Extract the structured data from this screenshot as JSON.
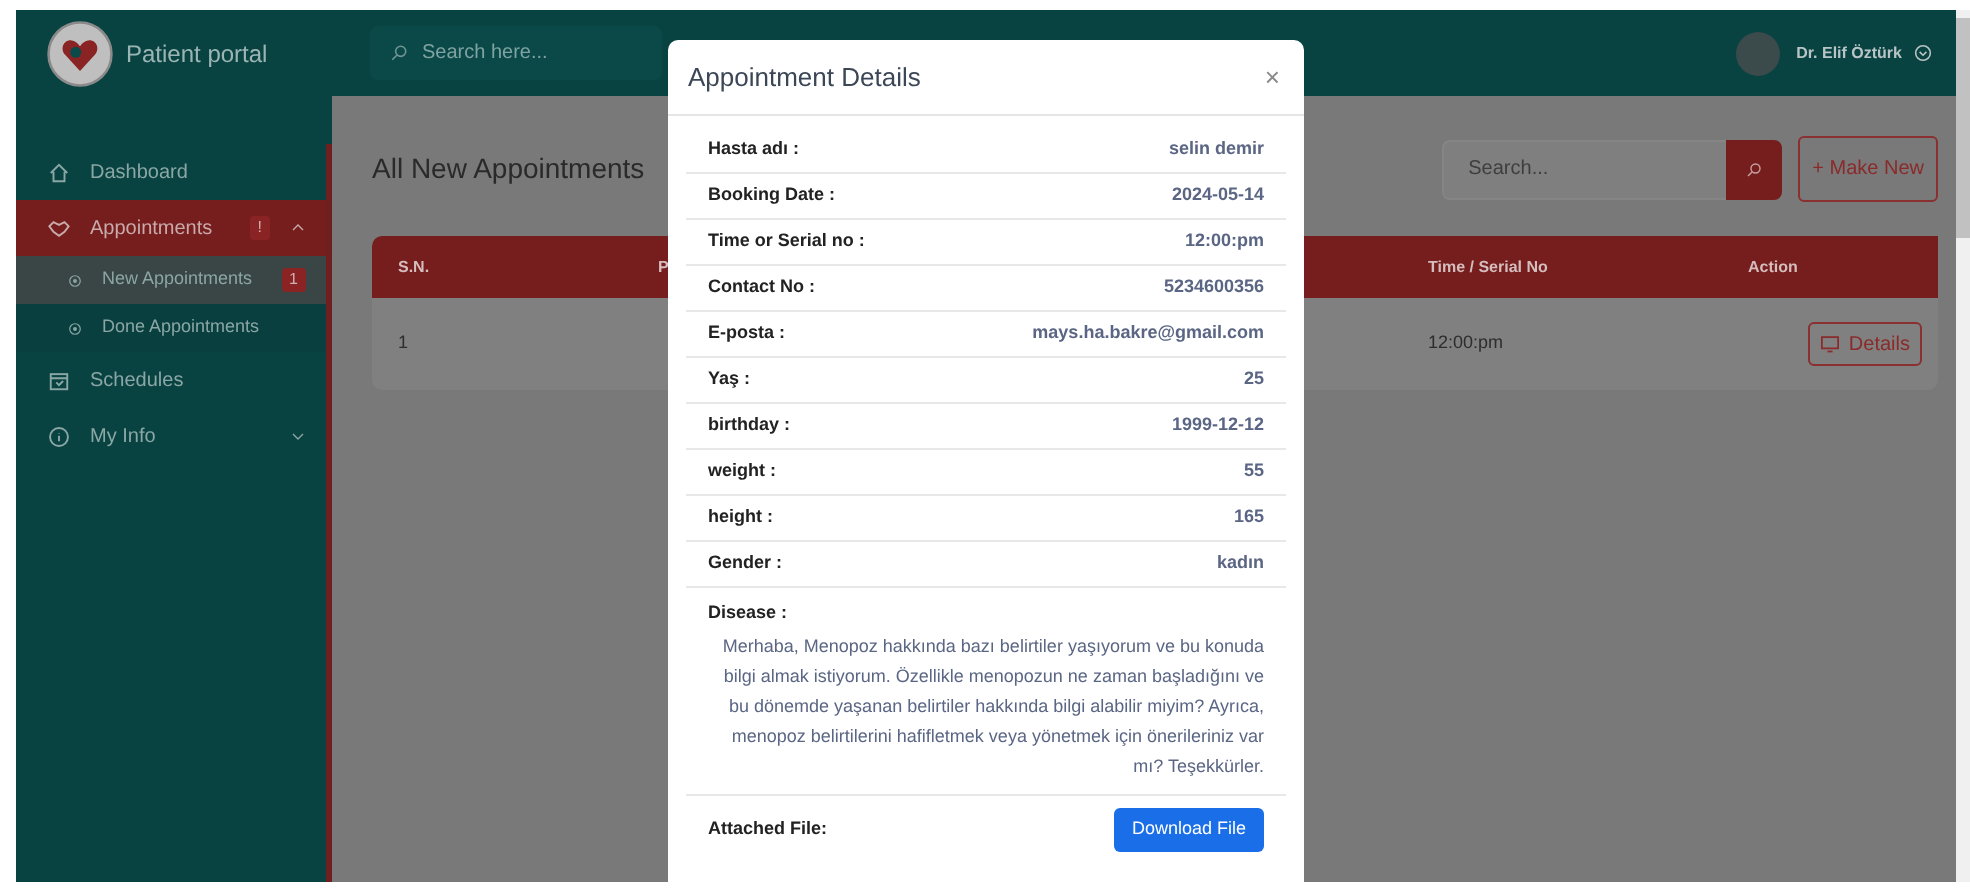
{
  "sidebar": {
    "brand": "Patient portal",
    "items": [
      {
        "kind": "link",
        "label": "Dashboard",
        "selected": false
      },
      {
        "kind": "group",
        "label": "Appointments",
        "badge": "!",
        "selected": true,
        "expanded": true,
        "children": [
          {
            "label": "New Appointments",
            "badge": "1",
            "selected": true
          },
          {
            "label": "Done Appointments",
            "selected": false
          }
        ]
      },
      {
        "kind": "link",
        "label": "Schedules",
        "selected": false
      },
      {
        "kind": "group",
        "label": "My Info",
        "selected": false,
        "expanded": false
      }
    ]
  },
  "header": {
    "search": {
      "placeholder": "Search here..."
    },
    "user": {
      "name": "Dr. Elif Öztürk"
    }
  },
  "content": {
    "title": "All New Appointments",
    "search": {
      "placeholder": "Search..."
    },
    "make_new_button": "+ Make New",
    "table": {
      "columns": [
        "S.N.",
        "P",
        "Time / Serial No",
        "Action"
      ],
      "rows": [
        {
          "sn": "1",
          "time": "12:00:pm",
          "action": "Details"
        }
      ]
    }
  },
  "modal": {
    "title": "Appointment Details",
    "close": "×",
    "fields": [
      {
        "label": "Hasta adı :",
        "value": "selin demir"
      },
      {
        "label": "Booking Date :",
        "value": "2024-05-14"
      },
      {
        "label": "Time or Serial no :",
        "value": "12:00:pm"
      },
      {
        "label": "Contact No :",
        "value": "5234600356"
      },
      {
        "label": "E-posta :",
        "value": "mays.ha.bakre@gmail.com"
      },
      {
        "label": "Yaş :",
        "value": "25"
      },
      {
        "label": "birthday :",
        "value": "1999-12-12"
      },
      {
        "label": "weight :",
        "value": "55"
      },
      {
        "label": "height :",
        "value": "165"
      },
      {
        "label": "Gender :",
        "value": "kadın"
      }
    ],
    "disease": {
      "label": "Disease :",
      "text": "Merhaba, Menopoz hakkında bazı belirtiler yaşıyorum ve bu konuda bilgi almak istiyorum. Özellikle menopozun ne zaman başladığını ve bu dönemde yaşanan belirtiler hakkında bilgi alabilir miyim? Ayrıca, menopoz belirtilerini hafifletmek veya yönetmek için önerileriniz var mı? Teşekkürler."
    },
    "attachment": {
      "label": "Attached File:",
      "button": "Download File"
    }
  }
}
